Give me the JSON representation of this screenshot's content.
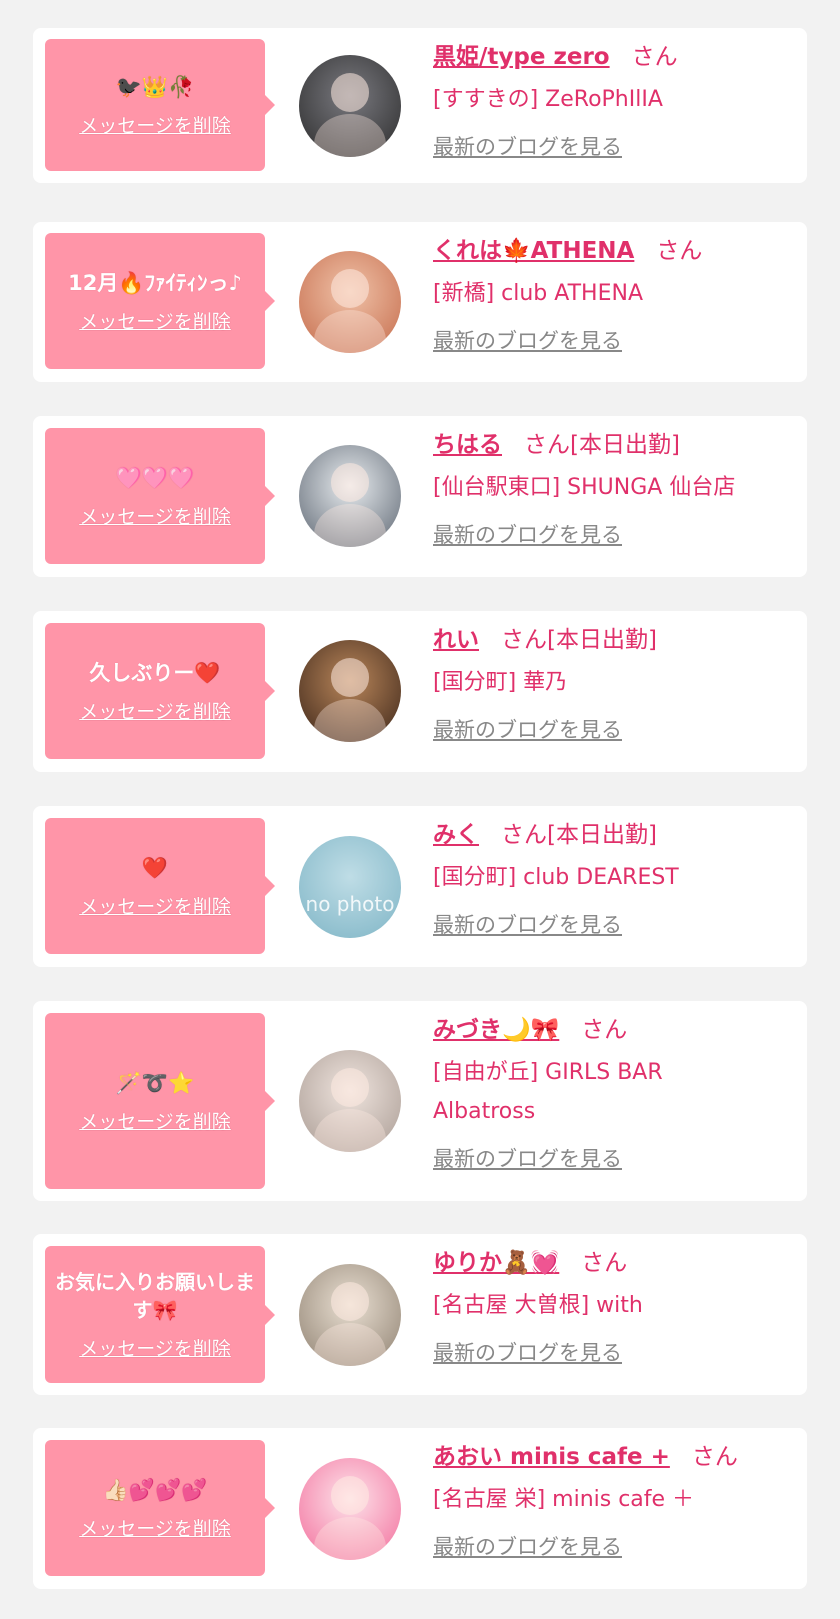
{
  "colors": {
    "page_bg": "#f2f2f2",
    "card_bg": "#ffffff",
    "bubble_bg": "#ff95a8",
    "accent_pink": "#e0306a",
    "muted_link": "#888888"
  },
  "cards": [
    {
      "message": "🐦‍⬛👑🥀",
      "delete_label": "メッセージを削除",
      "name": "黒姫/type zero",
      "honorific": "さん",
      "shop": "[すすきの] ZeRoPhIlIA",
      "blog_label": "最新のブログを見る",
      "avatar_colors": [
        "#2a2a2a",
        "#7a7a80"
      ]
    },
    {
      "message": "12月🔥ﾌｧｲﾃｨﾝっ♪",
      "delete_label": "メッセージを削除",
      "name": "くれは🍁ATHENA",
      "honorific": "さん",
      "shop": "[新橋] club ATHENA",
      "blog_label": "最新のブログを見る",
      "avatar_colors": [
        "#c46a4a",
        "#f0c2a8"
      ]
    },
    {
      "message": "🩷🩷🩷",
      "delete_label": "メッセージを削除",
      "name": "ちはる",
      "honorific": "さん[本日出勤]",
      "shop": "[仙台駅東口] SHUNGA 仙台店",
      "blog_label": "最新のブログを見る",
      "avatar_colors": [
        "#5b6470",
        "#e8ecef"
      ]
    },
    {
      "message": "久しぶりー❤️",
      "delete_label": "メッセージを削除",
      "name": "れい",
      "honorific": "さん[本日出勤]",
      "shop": "[国分町] 華乃",
      "blog_label": "最新のブログを見る",
      "avatar_colors": [
        "#3a2418",
        "#b9865a"
      ]
    },
    {
      "message": "❤️",
      "delete_label": "メッセージを削除",
      "name": "みく",
      "honorific": "さん[本日出勤]",
      "shop": "[国分町] club DEAREST",
      "blog_label": "最新のブログを見る",
      "avatar_colors": [
        "#7fb5c6",
        "#bfdde6"
      ],
      "avatar_text": "no photo"
    },
    {
      "message": "🪄➰⭐️",
      "delete_label": "メッセージを削除",
      "name": "みづき🌙🎀",
      "honorific": "さん",
      "shop": "[自由が丘] GIRLS BAR Albatross",
      "blog_label": "最新のブログを見る",
      "avatar_colors": [
        "#a89a92",
        "#efe4de"
      ]
    },
    {
      "message": "お気に入りお願いします🎀",
      "delete_label": "メッセージを削除",
      "name": "ゆりか🧸💓",
      "honorific": "さん",
      "shop": "[名古屋 大曽根] with",
      "blog_label": "最新のブログを見る",
      "avatar_colors": [
        "#8e8070",
        "#e9dfd2"
      ]
    },
    {
      "message": "👍🏻💕💕💕",
      "delete_label": "メッセージを削除",
      "name": "あおい minis cafe +",
      "honorific": "さん",
      "shop": "[名古屋 栄] minis cafe ＋",
      "blog_label": "最新のブログを見る",
      "avatar_colors": [
        "#f26b9a",
        "#fde3ea"
      ]
    }
  ]
}
